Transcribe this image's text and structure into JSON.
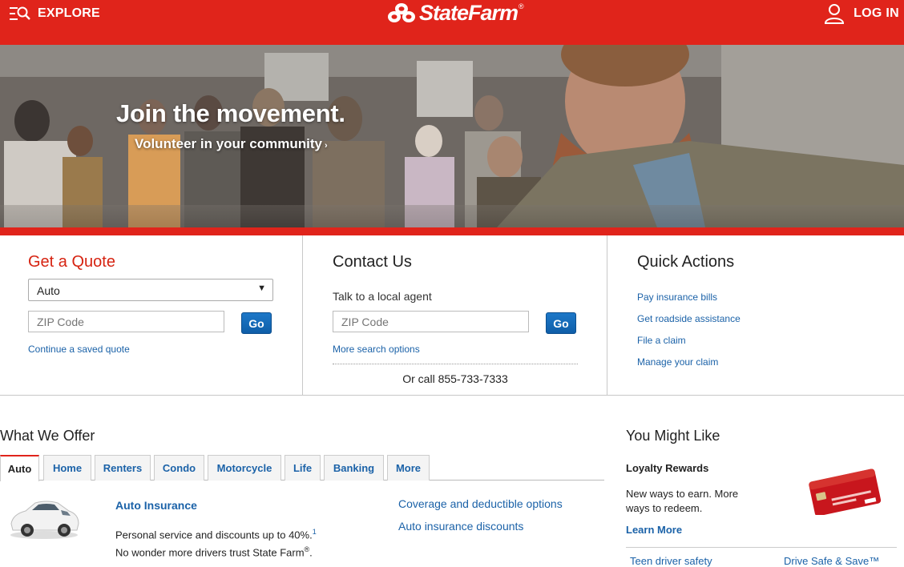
{
  "header": {
    "explore_label": "EXPLORE",
    "brand": "StateFarm",
    "brand_reg": "®",
    "login_label": "LOG IN"
  },
  "hero": {
    "title": "Join the movement.",
    "link": "Volunteer in your community",
    "link_arrow": "›"
  },
  "quote": {
    "title": "Get a Quote",
    "selected": "Auto",
    "zip_placeholder": "ZIP Code",
    "go": "Go",
    "saved_link": "Continue a saved quote"
  },
  "contact": {
    "title": "Contact Us",
    "subtitle": "Talk to a local agent",
    "zip_placeholder": "ZIP Code",
    "go": "Go",
    "more_link": "More search options",
    "call": "Or call 855-733-7333"
  },
  "quick": {
    "title": "Quick Actions",
    "items": [
      "Pay insurance bills",
      "Get roadside assistance",
      "File a claim",
      "Manage your claim"
    ]
  },
  "offer": {
    "title": "What We Offer",
    "tabs": [
      "Auto",
      "Home",
      "Renters",
      "Condo",
      "Motorcycle",
      "Life",
      "Banking",
      "More"
    ],
    "product_title": "Auto Insurance",
    "product_text_1": "Personal service and discounts up to 40%.",
    "product_sup": "1",
    "product_text_2": " No wonder more drivers trust State Farm",
    "product_reg": "®",
    "product_text_3": ".",
    "links": [
      "Coverage and deductible options",
      "Auto insurance discounts"
    ]
  },
  "might_like": {
    "title": "You Might Like",
    "promo_title": "Loyalty Rewards",
    "promo_text": "New ways to earn. More ways to redeem.",
    "learn_more": "Learn More",
    "bottom_links": [
      "Teen driver safety",
      "Drive Safe & Save™"
    ]
  },
  "colors": {
    "brand_red": "#e0241b",
    "link_blue": "#1b62a8",
    "button_blue": "#1567b7"
  }
}
